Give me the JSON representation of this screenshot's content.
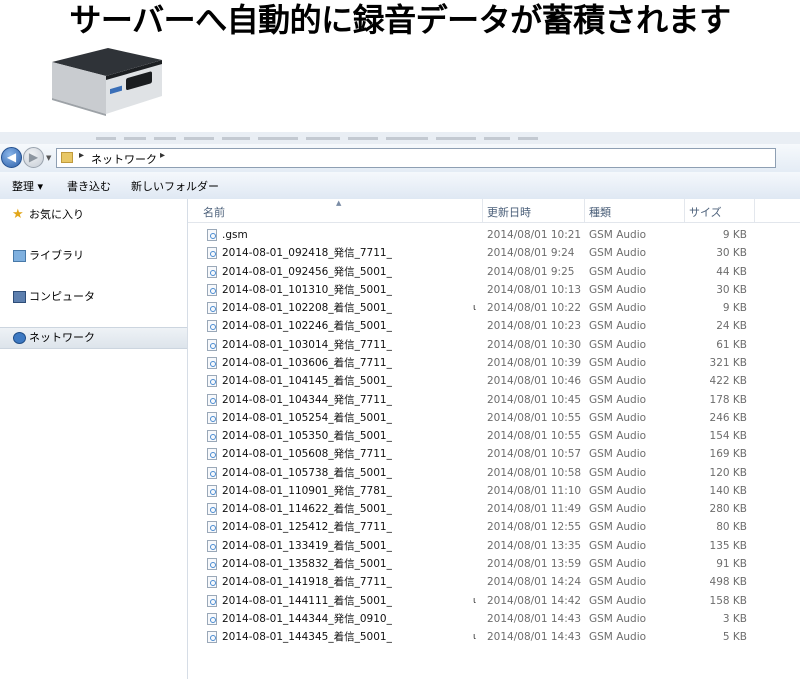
{
  "headline": "サーバーへ自動的に録音データが蓄積されます",
  "address_bar": {
    "path": [
      "ネットワーク"
    ]
  },
  "toolbar": {
    "organize": "整理 ▾",
    "burn": "書き込む",
    "new_folder": "新しいフォルダー"
  },
  "nav_pane": [
    {
      "label": "お気に入り",
      "icon": "star-icon"
    },
    {
      "label": "ライブラリ",
      "icon": "library-icon"
    },
    {
      "label": "コンピュータ",
      "icon": "computer-icon"
    },
    {
      "label": "ネットワーク",
      "icon": "network-icon",
      "selected": true
    }
  ],
  "columns": {
    "name": "名前",
    "date": "更新日時",
    "type": "種類",
    "size": "サイズ"
  },
  "files": [
    {
      "name": ".gsm",
      "date": "2014/08/01 10:21",
      "type": "GSM Audio",
      "size": "9 KB"
    },
    {
      "name": "2014-08-01_092418_発信_7711_",
      "date": "2014/08/01 9:24",
      "type": "GSM Audio",
      "size": "30 KB"
    },
    {
      "name": "2014-08-01_092456_発信_5001_",
      "date": "2014/08/01 9:25",
      "type": "GSM Audio",
      "size": "44 KB"
    },
    {
      "name": "2014-08-01_101310_発信_5001_",
      "date": "2014/08/01 10:13",
      "type": "GSM Audio",
      "size": "30 KB"
    },
    {
      "name": "2014-08-01_102208_着信_5001_",
      "date": "2014/08/01 10:22",
      "type": "GSM Audio",
      "size": "9 KB",
      "mark": "ι"
    },
    {
      "name": "2014-08-01_102246_着信_5001_",
      "date": "2014/08/01 10:23",
      "type": "GSM Audio",
      "size": "24 KB"
    },
    {
      "name": "2014-08-01_103014_発信_7711_",
      "date": "2014/08/01 10:30",
      "type": "GSM Audio",
      "size": "61 KB"
    },
    {
      "name": "2014-08-01_103606_着信_7711_",
      "date": "2014/08/01 10:39",
      "type": "GSM Audio",
      "size": "321 KB"
    },
    {
      "name": "2014-08-01_104145_着信_5001_",
      "date": "2014/08/01 10:46",
      "type": "GSM Audio",
      "size": "422 KB"
    },
    {
      "name": "2014-08-01_104344_発信_7711_",
      "date": "2014/08/01 10:45",
      "type": "GSM Audio",
      "size": "178 KB"
    },
    {
      "name": "2014-08-01_105254_着信_5001_",
      "date": "2014/08/01 10:55",
      "type": "GSM Audio",
      "size": "246 KB"
    },
    {
      "name": "2014-08-01_105350_着信_5001_",
      "date": "2014/08/01 10:55",
      "type": "GSM Audio",
      "size": "154 KB"
    },
    {
      "name": "2014-08-01_105608_発信_7711_",
      "date": "2014/08/01 10:57",
      "type": "GSM Audio",
      "size": "169 KB"
    },
    {
      "name": "2014-08-01_105738_着信_5001_",
      "date": "2014/08/01 10:58",
      "type": "GSM Audio",
      "size": "120 KB"
    },
    {
      "name": "2014-08-01_110901_発信_7781_",
      "date": "2014/08/01 11:10",
      "type": "GSM Audio",
      "size": "140 KB"
    },
    {
      "name": "2014-08-01_114622_着信_5001_",
      "date": "2014/08/01 11:49",
      "type": "GSM Audio",
      "size": "280 KB"
    },
    {
      "name": "2014-08-01_125412_着信_7711_",
      "date": "2014/08/01 12:55",
      "type": "GSM Audio",
      "size": "80 KB"
    },
    {
      "name": "2014-08-01_133419_着信_5001_",
      "date": "2014/08/01 13:35",
      "type": "GSM Audio",
      "size": "135 KB"
    },
    {
      "name": "2014-08-01_135832_着信_5001_",
      "date": "2014/08/01 13:59",
      "type": "GSM Audio",
      "size": "91 KB"
    },
    {
      "name": "2014-08-01_141918_着信_7711_",
      "date": "2014/08/01 14:24",
      "type": "GSM Audio",
      "size": "498 KB"
    },
    {
      "name": "2014-08-01_144111_着信_5001_",
      "date": "2014/08/01 14:42",
      "type": "GSM Audio",
      "size": "158 KB",
      "mark": "ι"
    },
    {
      "name": "2014-08-01_144344_発信_0910_",
      "date": "2014/08/01 14:43",
      "type": "GSM Audio",
      "size": "3 KB"
    },
    {
      "name": "2014-08-01_144345_着信_5001_",
      "date": "2014/08/01 14:43",
      "type": "GSM Audio",
      "size": "5 KB",
      "mark": "ι"
    }
  ]
}
